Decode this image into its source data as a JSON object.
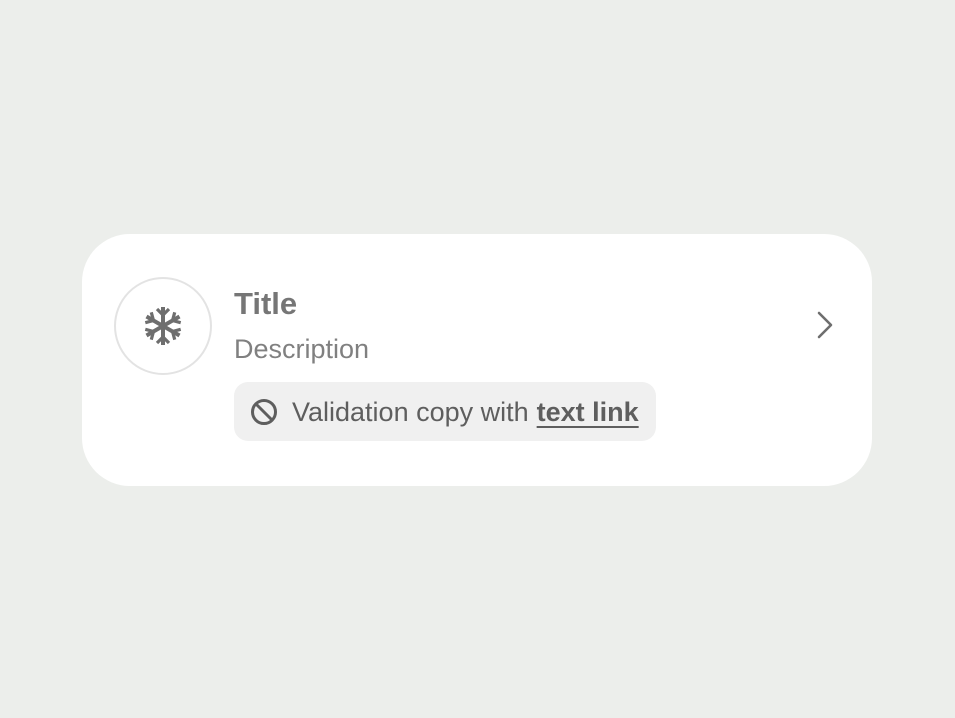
{
  "card": {
    "title": "Title",
    "description": "Description",
    "leading_icon": "snowflake-icon",
    "trailing_icon": "chevron-right-icon",
    "validation": {
      "icon": "ban-icon",
      "copy": "Validation copy with",
      "link_text": "text link"
    }
  },
  "colors": {
    "background": "#ECEEEB",
    "card": "#FFFFFF",
    "title": "#767676",
    "description": "#808080",
    "validation_bg": "#F0F0F0",
    "validation_text": "#5E5E5E",
    "icon": "#6E6E6E"
  }
}
